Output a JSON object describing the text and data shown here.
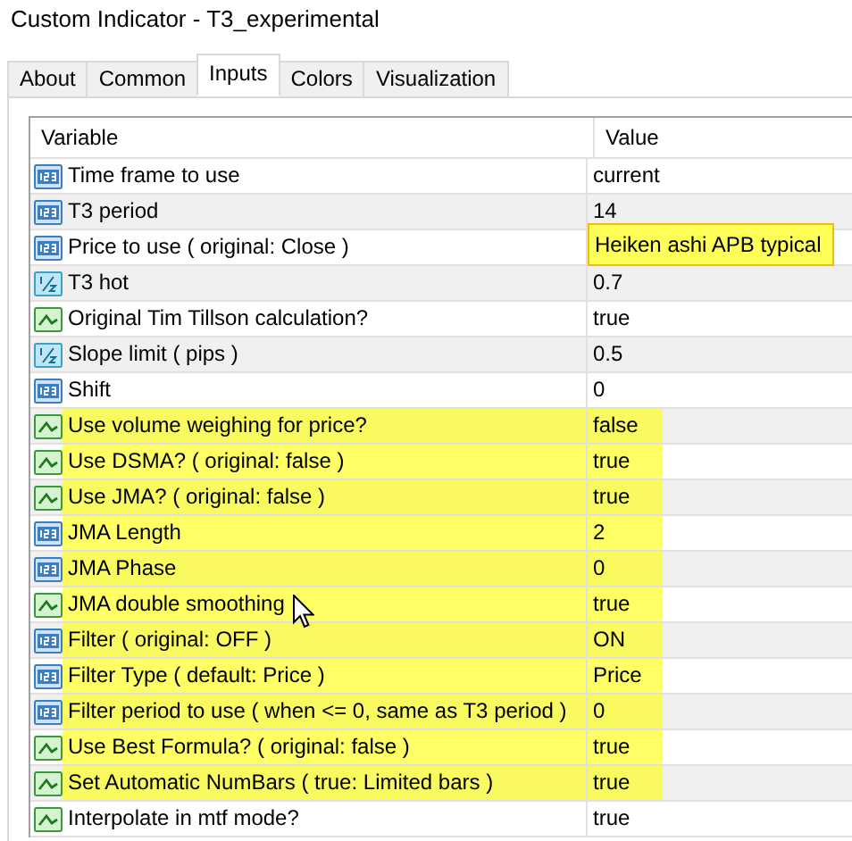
{
  "window": {
    "title": "Custom Indicator - T3_experimental"
  },
  "tabs": [
    {
      "label": "About",
      "selected": false
    },
    {
      "label": "Common",
      "selected": false
    },
    {
      "label": "Inputs",
      "selected": true
    },
    {
      "label": "Colors",
      "selected": false
    },
    {
      "label": "Visualization",
      "selected": false
    }
  ],
  "table": {
    "columns": [
      "Variable",
      "Value"
    ],
    "rows": [
      {
        "kind": "int",
        "name": "Time frame to use",
        "value": "current",
        "row_highlighted": false,
        "value_highlighted": false
      },
      {
        "kind": "int",
        "name": "T3 period",
        "value": "14",
        "row_highlighted": false,
        "value_highlighted": false
      },
      {
        "kind": "int",
        "name": "Price to use ( original: Close )",
        "value": "Heiken ashi APB typical",
        "row_highlighted": false,
        "value_highlighted": true
      },
      {
        "kind": "double",
        "name": "T3 hot",
        "value": "0.7",
        "row_highlighted": false,
        "value_highlighted": false
      },
      {
        "kind": "bool",
        "name": "Original Tim Tillson calculation?",
        "value": "true",
        "row_highlighted": false,
        "value_highlighted": false
      },
      {
        "kind": "double",
        "name": "Slope limit ( pips )",
        "value": "0.5",
        "row_highlighted": false,
        "value_highlighted": false
      },
      {
        "kind": "int",
        "name": "Shift",
        "value": "0",
        "row_highlighted": false,
        "value_highlighted": false
      },
      {
        "kind": "bool",
        "name": "Use volume weighing for price?",
        "value": "false",
        "row_highlighted": true,
        "value_highlighted": false
      },
      {
        "kind": "bool",
        "name": "Use DSMA? ( original: false )",
        "value": "true",
        "row_highlighted": true,
        "value_highlighted": false
      },
      {
        "kind": "bool",
        "name": "Use JMA?  ( original: false )",
        "value": "true",
        "row_highlighted": true,
        "value_highlighted": false
      },
      {
        "kind": "int",
        "name": "JMA Length",
        "value": "2",
        "row_highlighted": true,
        "value_highlighted": false
      },
      {
        "kind": "int",
        "name": "JMA Phase",
        "value": "0",
        "row_highlighted": true,
        "value_highlighted": false
      },
      {
        "kind": "bool",
        "name": "JMA double smoothing",
        "value": "true",
        "row_highlighted": true,
        "value_highlighted": false
      },
      {
        "kind": "int",
        "name": "Filter ( original: OFF )",
        "value": "ON",
        "row_highlighted": true,
        "value_highlighted": false
      },
      {
        "kind": "int",
        "name": "Filter Type ( default: Price )",
        "value": "Price",
        "row_highlighted": true,
        "value_highlighted": false
      },
      {
        "kind": "int",
        "name": "Filter period to use ( when <= 0, same as T3 period )",
        "value": "0",
        "row_highlighted": true,
        "value_highlighted": false
      },
      {
        "kind": "bool",
        "name": "Use Best Formula? ( original: false )",
        "value": "true",
        "row_highlighted": true,
        "value_highlighted": false
      },
      {
        "kind": "bool",
        "name": "Set Automatic NumBars ( true: Limited bars )",
        "value": "true",
        "row_highlighted": true,
        "value_highlighted": false
      },
      {
        "kind": "bool",
        "name": "Interpolate in mtf mode?",
        "value": "true",
        "row_highlighted": false,
        "value_highlighted": false
      }
    ]
  }
}
